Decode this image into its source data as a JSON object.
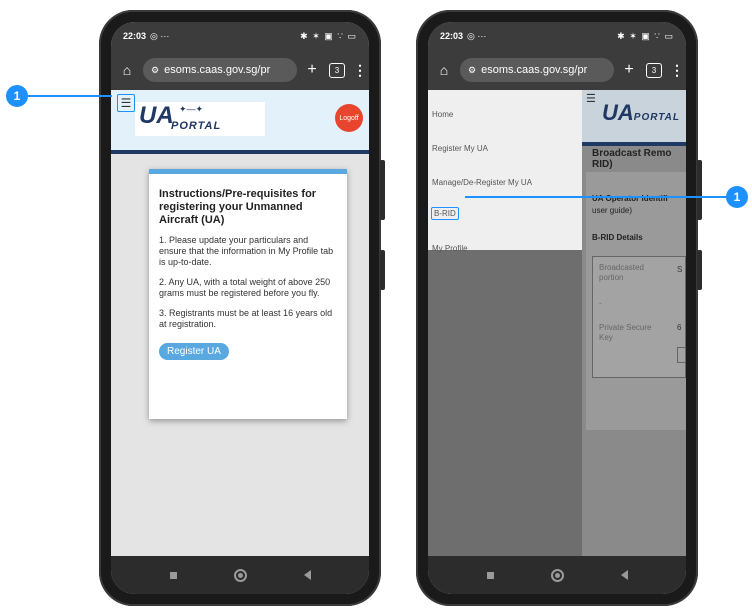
{
  "status": {
    "time": "22:03",
    "extra": "◎ ···",
    "icons": "✱ ✶ ▣ ∵ ▭"
  },
  "browser": {
    "url": "esoms.caas.gov.sg/pr",
    "tab_count": "3"
  },
  "left_phone": {
    "logo_main": "UA",
    "logo_sub": "PORTAL",
    "logoff_label": "Logoff",
    "card": {
      "title": "Instructions/Pre-requisites for registering your Unmanned Aircraft (UA)",
      "items": [
        "1. Please update your particulars and ensure that the information in My Profile tab is up-to-date.",
        "2. Any UA, with a total weight of above 250 grams must be registered before you fly.",
        "3. Registrants must be at least 16 years old at registration."
      ],
      "button": "Register UA"
    }
  },
  "right_phone": {
    "menu": [
      "Home",
      "Register My UA",
      "Manage/De-Register My UA",
      "B-RID",
      "My Profile"
    ],
    "page_title": "Broadcast Remo RID)",
    "operator_label": "UA Operator Identifi",
    "operator_sub": "user guide)",
    "details_label": "B-RID Details",
    "fields": [
      "Broadcasted portion",
      "-",
      "Private Secure Key"
    ],
    "values": [
      "S",
      "6"
    ]
  },
  "callouts": {
    "left": "1",
    "right": "1",
    "color": "#1e90ff"
  }
}
